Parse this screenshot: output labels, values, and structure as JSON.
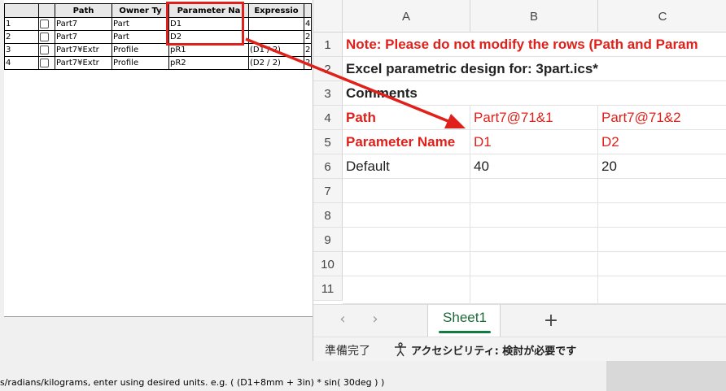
{
  "bg_table": {
    "headers": [
      "",
      "",
      "Path",
      "Owner Ty",
      "Parameter Na",
      "Expressio",
      ""
    ],
    "rows": [
      {
        "num": "1",
        "path": "Part7",
        "owner": "Part",
        "param": "D1",
        "expr": "",
        "extra": "4"
      },
      {
        "num": "2",
        "path": "Part7",
        "owner": "Part",
        "param": "D2",
        "expr": "",
        "extra": "2"
      },
      {
        "num": "3",
        "path": "Part7¥Extr",
        "owner": "Profile",
        "param": "pR1",
        "expr": "(D1 / 2)",
        "extra": "2"
      },
      {
        "num": "4",
        "path": "Part7¥Extr",
        "owner": "Profile",
        "param": "pR2",
        "expr": "(D2 / 2)",
        "extra": "2"
      }
    ]
  },
  "bg_status": "s/radians/kilograms, enter using desired units. e.g. ( (D1+8mm + 3in) * sin( 30deg ) )",
  "excel": {
    "columns": [
      "A",
      "B",
      "C"
    ],
    "row_numbers": [
      "1",
      "2",
      "3",
      "4",
      "5",
      "6",
      "7",
      "8",
      "9",
      "10",
      "11"
    ],
    "rows": {
      "r1_a": "Note: Please do not modify the rows (Path and Param",
      "r2_a": "Excel parametric design for: 3part.ics*",
      "r3_a": "Comments",
      "r4_a": "Path",
      "r4_b": "Part7@71&1",
      "r4_c": "Part7@71&2",
      "r5_a": "Parameter Name",
      "r5_b": "D1",
      "r5_c": "D2",
      "r6_a": "Default",
      "r6_b": "40",
      "r6_c": "20"
    },
    "sheet_tab": "Sheet1",
    "nav_prev_icon": "chevron-left-icon",
    "nav_next_icon": "chevron-right-icon",
    "add_icon": "plus-icon",
    "status_ready": "準備完了",
    "status_accessibility": "アクセシビリティ: 検討が必要です"
  },
  "colors": {
    "accent_red": "#e0201a",
    "sheet_green": "#107c41"
  }
}
